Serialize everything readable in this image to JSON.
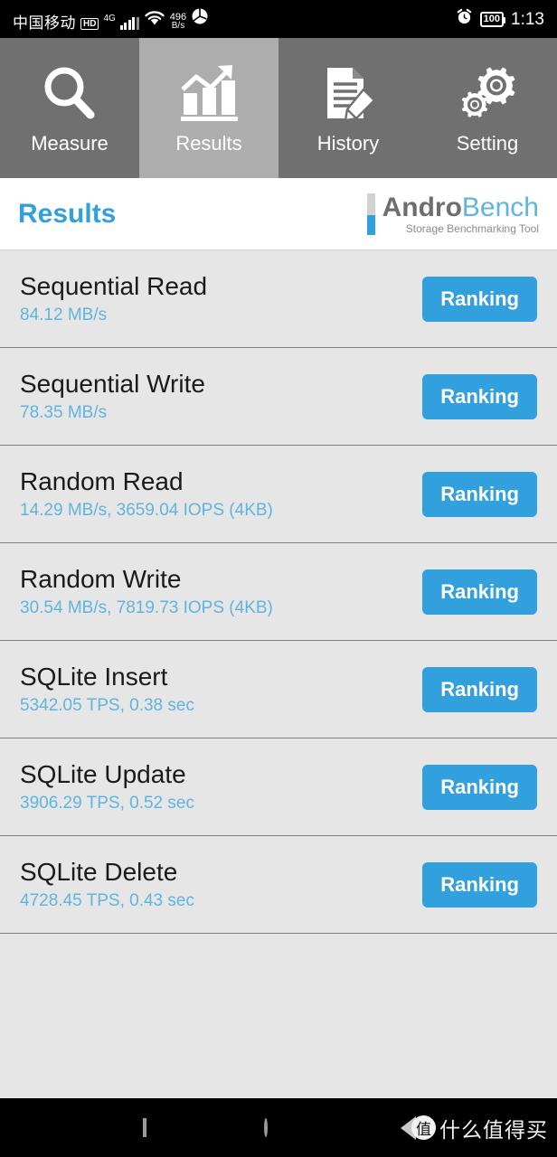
{
  "statusbar": {
    "carrier": "中国移动",
    "hd_badge": "HD",
    "network_type": "4G",
    "data_speed_value": "496",
    "data_speed_unit": "B/s",
    "battery_level": "100",
    "time": "1:13",
    "icons": [
      "hd-icon",
      "signal-icon",
      "wifi-icon",
      "data-speed-icon",
      "globe-icon",
      "alarm-icon",
      "battery-icon"
    ]
  },
  "tabs": [
    {
      "label": "Measure",
      "icon": "magnifier-icon",
      "active": false
    },
    {
      "label": "Results",
      "icon": "bar-chart-icon",
      "active": true
    },
    {
      "label": "History",
      "icon": "document-pencil-icon",
      "active": false
    },
    {
      "label": "Setting",
      "icon": "gears-icon",
      "active": false
    }
  ],
  "header": {
    "title": "Results",
    "logo_andro": "Andro",
    "logo_bench": "Bench",
    "logo_subtitle": "Storage Benchmarking Tool"
  },
  "colors": {
    "accent_blue": "#32a0dc",
    "value_blue": "#5fb4e0",
    "tab_bg": "#707070",
    "tab_active_bg": "#adadad",
    "list_bg": "#e6e6e6"
  },
  "results": [
    {
      "title": "Sequential Read",
      "value": "84.12 MB/s",
      "button": "Ranking"
    },
    {
      "title": "Sequential Write",
      "value": "78.35 MB/s",
      "button": "Ranking"
    },
    {
      "title": "Random Read",
      "value": "14.29 MB/s, 3659.04 IOPS (4KB)",
      "button": "Ranking"
    },
    {
      "title": "Random Write",
      "value": "30.54 MB/s, 7819.73 IOPS (4KB)",
      "button": "Ranking"
    },
    {
      "title": "SQLite Insert",
      "value": "5342.05 TPS, 0.38 sec",
      "button": "Ranking"
    },
    {
      "title": "SQLite Update",
      "value": "3906.29 TPS, 0.52 sec",
      "button": "Ranking"
    },
    {
      "title": "SQLite Delete",
      "value": "4728.45 TPS, 0.43 sec",
      "button": "Ranking"
    }
  ],
  "navbar": {
    "recents_icon": "square-icon",
    "home_icon": "circle-icon",
    "back_icon": "back-triangle-icon",
    "watermark_badge": "值",
    "watermark_text": "什么值得买"
  }
}
